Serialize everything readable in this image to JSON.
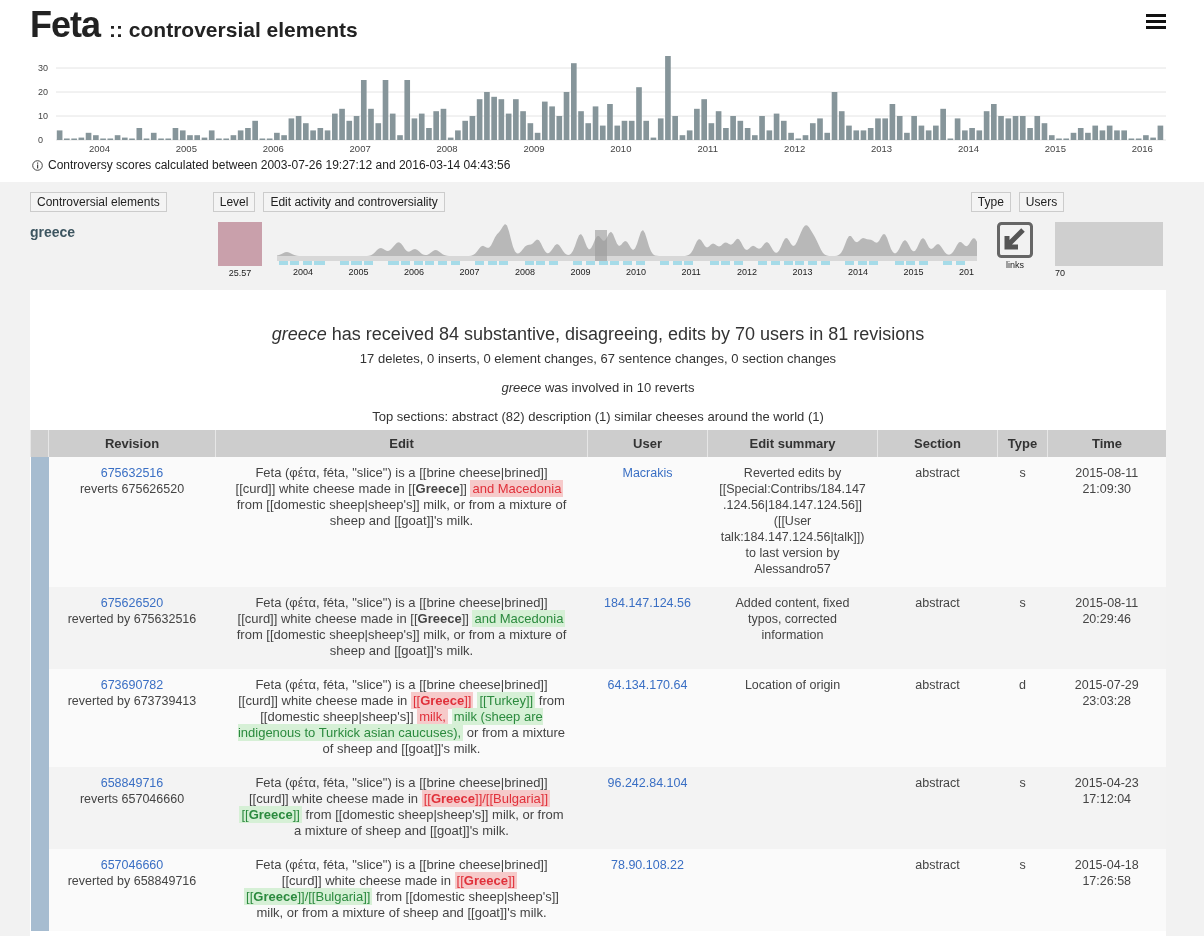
{
  "header": {
    "title": "Feta",
    "subtitle": ":: controversial elements"
  },
  "timeline": {
    "chart_data": {
      "type": "bar",
      "ylim": [
        0,
        35
      ],
      "yticks": [
        0,
        10,
        20,
        30
      ],
      "grid": true,
      "xlim": [
        2003.5,
        2016.25
      ],
      "x": [
        2003.5,
        2003.583,
        2003.667,
        2003.75,
        2003.833,
        2003.917,
        2004,
        2004.083,
        2004.167,
        2004.25,
        2004.333,
        2004.417,
        2004.5,
        2004.583,
        2004.667,
        2004.75,
        2004.833,
        2004.917,
        2005,
        2005.083,
        2005.167,
        2005.25,
        2005.333,
        2005.417,
        2005.5,
        2005.583,
        2005.667,
        2005.75,
        2005.833,
        2005.917,
        2006,
        2006.083,
        2006.167,
        2006.25,
        2006.333,
        2006.417,
        2006.5,
        2006.583,
        2006.667,
        2006.75,
        2006.833,
        2006.917,
        2007,
        2007.083,
        2007.167,
        2007.25,
        2007.333,
        2007.417,
        2007.5,
        2007.583,
        2007.667,
        2007.75,
        2007.833,
        2007.917,
        2008,
        2008.083,
        2008.167,
        2008.25,
        2008.333,
        2008.417,
        2008.5,
        2008.583,
        2008.667,
        2008.75,
        2008.833,
        2008.917,
        2009,
        2009.083,
        2009.167,
        2009.25,
        2009.333,
        2009.417,
        2009.5,
        2009.583,
        2009.667,
        2009.75,
        2009.833,
        2009.917,
        2010,
        2010.083,
        2010.167,
        2010.25,
        2010.333,
        2010.417,
        2010.5,
        2010.583,
        2010.667,
        2010.75,
        2010.833,
        2010.917,
        2011,
        2011.083,
        2011.167,
        2011.25,
        2011.333,
        2011.417,
        2011.5,
        2011.583,
        2011.667,
        2011.75,
        2011.833,
        2011.917,
        2012,
        2012.083,
        2012.167,
        2012.25,
        2012.333,
        2012.417,
        2012.5,
        2012.583,
        2012.667,
        2012.75,
        2012.833,
        2012.917,
        2013,
        2013.083,
        2013.167,
        2013.25,
        2013.333,
        2013.417,
        2013.5,
        2013.583,
        2013.667,
        2013.75,
        2013.833,
        2013.917,
        2014,
        2014.083,
        2014.167,
        2014.25,
        2014.333,
        2014.417,
        2014.5,
        2014.583,
        2014.667,
        2014.75,
        2014.833,
        2014.917,
        2015,
        2015.083,
        2015.167,
        2015.25,
        2015.333,
        2015.417,
        2015.5,
        2015.583,
        2015.667,
        2015.75,
        2015.833,
        2015.917,
        2016,
        2016.083,
        2016.167
      ],
      "values": [
        4,
        0,
        0,
        1,
        3,
        2,
        0,
        0,
        2,
        1,
        0,
        5,
        0,
        3,
        0,
        0,
        5,
        4,
        2,
        2,
        1,
        4,
        0,
        0,
        2,
        4,
        5,
        8,
        0,
        0,
        3,
        2,
        9,
        10,
        7,
        4,
        5,
        4,
        11,
        13,
        8,
        10,
        25,
        13,
        7,
        25,
        11,
        2,
        25,
        9,
        11,
        5,
        12,
        13,
        1,
        4,
        8,
        10,
        17,
        20,
        18,
        17,
        11,
        17,
        12,
        7,
        3,
        16,
        14,
        10,
        20,
        32,
        12,
        7,
        14,
        6,
        15,
        6,
        8,
        8,
        22,
        8,
        1,
        9,
        35,
        10,
        2,
        4,
        13,
        17,
        7,
        12,
        5,
        10,
        8,
        5,
        2,
        10,
        4,
        11,
        8,
        3,
        0,
        2,
        7,
        9,
        3,
        20,
        12,
        6,
        4,
        4,
        5,
        9,
        9,
        15,
        10,
        3,
        10,
        6,
        4,
        6,
        13,
        0,
        9,
        4,
        5,
        4,
        12,
        15,
        10,
        9,
        10,
        10,
        5,
        10,
        7,
        2,
        0,
        0,
        3,
        5,
        3,
        6,
        4,
        6,
        4,
        4,
        0,
        0,
        2,
        1,
        6
      ],
      "xticks": [
        2004,
        2005,
        2006,
        2007,
        2008,
        2009,
        2010,
        2011,
        2012,
        2013,
        2014,
        2015,
        2016
      ]
    }
  },
  "info": "Controversy scores calculated between 2003-07-26 19:27:12 and 2016-03-14 04:43:56",
  "controls": [
    "Controversial elements",
    "Level",
    "Edit activity and controversiality",
    "Type",
    "Users"
  ],
  "element": {
    "name": "greece",
    "level": "25.57",
    "activity_axis": [
      "2004",
      "2005",
      "2006",
      "2007",
      "2008",
      "2009",
      "2010",
      "2011",
      "2012",
      "2013",
      "2014",
      "2015",
      "201"
    ],
    "type_label": "links",
    "users": "70"
  },
  "summary": {
    "headline": "*greece* has received 84 substantive, disagreeing, edits by 70 users in 81 revisions",
    "counts": "17 deletes, 0 inserts, 0 element changes, 67 sentence changes, 0 section changes",
    "reverts": "*greece* was involved in 10 reverts",
    "top_sections": "Top sections: abstract (82) description (1) similar cheeses around the world (1)"
  },
  "table": {
    "columns": [
      "Revision",
      "Edit",
      "User",
      "Edit summary",
      "Section",
      "Type",
      "Time"
    ],
    "rows": [
      {
        "revision": "675632516",
        "relation": "reverts 675626520",
        "edit": [
          {
            "kind": "plain",
            "text": "Feta (φέτα, féta, \"slice\") is a [[brine cheese|brined]] [[curd]] white cheese made in [[**Greece**]] "
          },
          {
            "kind": "deleted",
            "text": "and Macedonia"
          },
          {
            "kind": "plain",
            "text": " from [[domestic sheep|sheep's]] milk, or from a mixture of sheep and [[goat]]'s milk."
          }
        ],
        "user": "Macrakis",
        "summary": "Reverted edits by [[Special:Contribs/184.147.124.56|184.147.124.56]] ([[User talk:184.147.124.56|talk]]) to last version by Alessandro57",
        "section": "abstract",
        "type": "s",
        "time": [
          "2015-08-11",
          "21:09:30"
        ]
      },
      {
        "revision": "675626520",
        "relation": "reverted by 675632516",
        "edit": [
          {
            "kind": "plain",
            "text": "Feta (φέτα, féta, \"slice\") is a [[brine cheese|brined]] [[curd]] white cheese made in [[**Greece**]] "
          },
          {
            "kind": "inserted",
            "text": "and Macedonia"
          },
          {
            "kind": "plain",
            "text": " from [[domestic sheep|sheep's]] milk, or from a mixture of sheep and [[goat]]'s milk."
          }
        ],
        "user": "184.147.124.56",
        "summary": "Added content, fixed typos, corrected information",
        "section": "abstract",
        "type": "s",
        "time": [
          "2015-08-11",
          "20:29:46"
        ]
      },
      {
        "revision": "673690782",
        "relation": "reverted by 673739413",
        "edit": [
          {
            "kind": "plain",
            "text": "Feta (φέτα, féta, \"slice\") is a [[brine cheese|brined]] [[curd]] white cheese made in "
          },
          {
            "kind": "deleted",
            "text": "[[**Greece**]]"
          },
          {
            "kind": "inserted",
            "text": "[[Turkey]]"
          },
          {
            "kind": "plain",
            "text": " from [[domestic sheep|sheep's]] "
          },
          {
            "kind": "deleted",
            "text": "milk,"
          },
          {
            "kind": "inserted",
            "text": "milk (sheep are indigenous to Turkick asian caucuses),"
          },
          {
            "kind": "plain",
            "text": " or from a mixture of sheep and [[goat]]'s milk."
          }
        ],
        "user": "64.134.170.64",
        "summary": "Location of origin",
        "section": "abstract",
        "type": "d",
        "time": [
          "2015-07-29",
          "23:03:28"
        ]
      },
      {
        "revision": "658849716",
        "relation": "reverts 657046660",
        "edit": [
          {
            "kind": "plain",
            "text": "Feta (φέτα, féta, \"slice\") is a [[brine cheese|brined]] [[curd]] white cheese made in "
          },
          {
            "kind": "deleted",
            "text": "[[**Greece**]]/[[Bulgaria]]"
          },
          {
            "kind": "inserted",
            "text": "[[**Greece**]]"
          },
          {
            "kind": "plain",
            "text": " from [[domestic sheep|sheep's]] milk, or from a mixture of sheep and [[goat]]'s milk."
          }
        ],
        "user": "96.242.84.104",
        "section": "abstract",
        "type": "s",
        "time": [
          "2015-04-23",
          "17:12:04"
        ]
      },
      {
        "revision": "657046660",
        "relation": "reverted by 658849716",
        "edit": [
          {
            "kind": "plain",
            "text": "Feta (φέτα, féta, \"slice\") is a [[brine cheese|brined]] [[curd]] white cheese made in "
          },
          {
            "kind": "deleted",
            "text": "[[**Greece**]]"
          },
          {
            "kind": "inserted",
            "text": "[[**Greece**]]/[[Bulgaria]]"
          },
          {
            "kind": "plain",
            "text": " from [[domestic sheep|sheep's]] milk, or from a mixture of sheep and [[goat]]'s milk."
          }
        ],
        "user": "78.90.108.22",
        "section": "abstract",
        "type": "s",
        "time": [
          "2015-04-18",
          "17:26:58"
        ]
      }
    ]
  }
}
